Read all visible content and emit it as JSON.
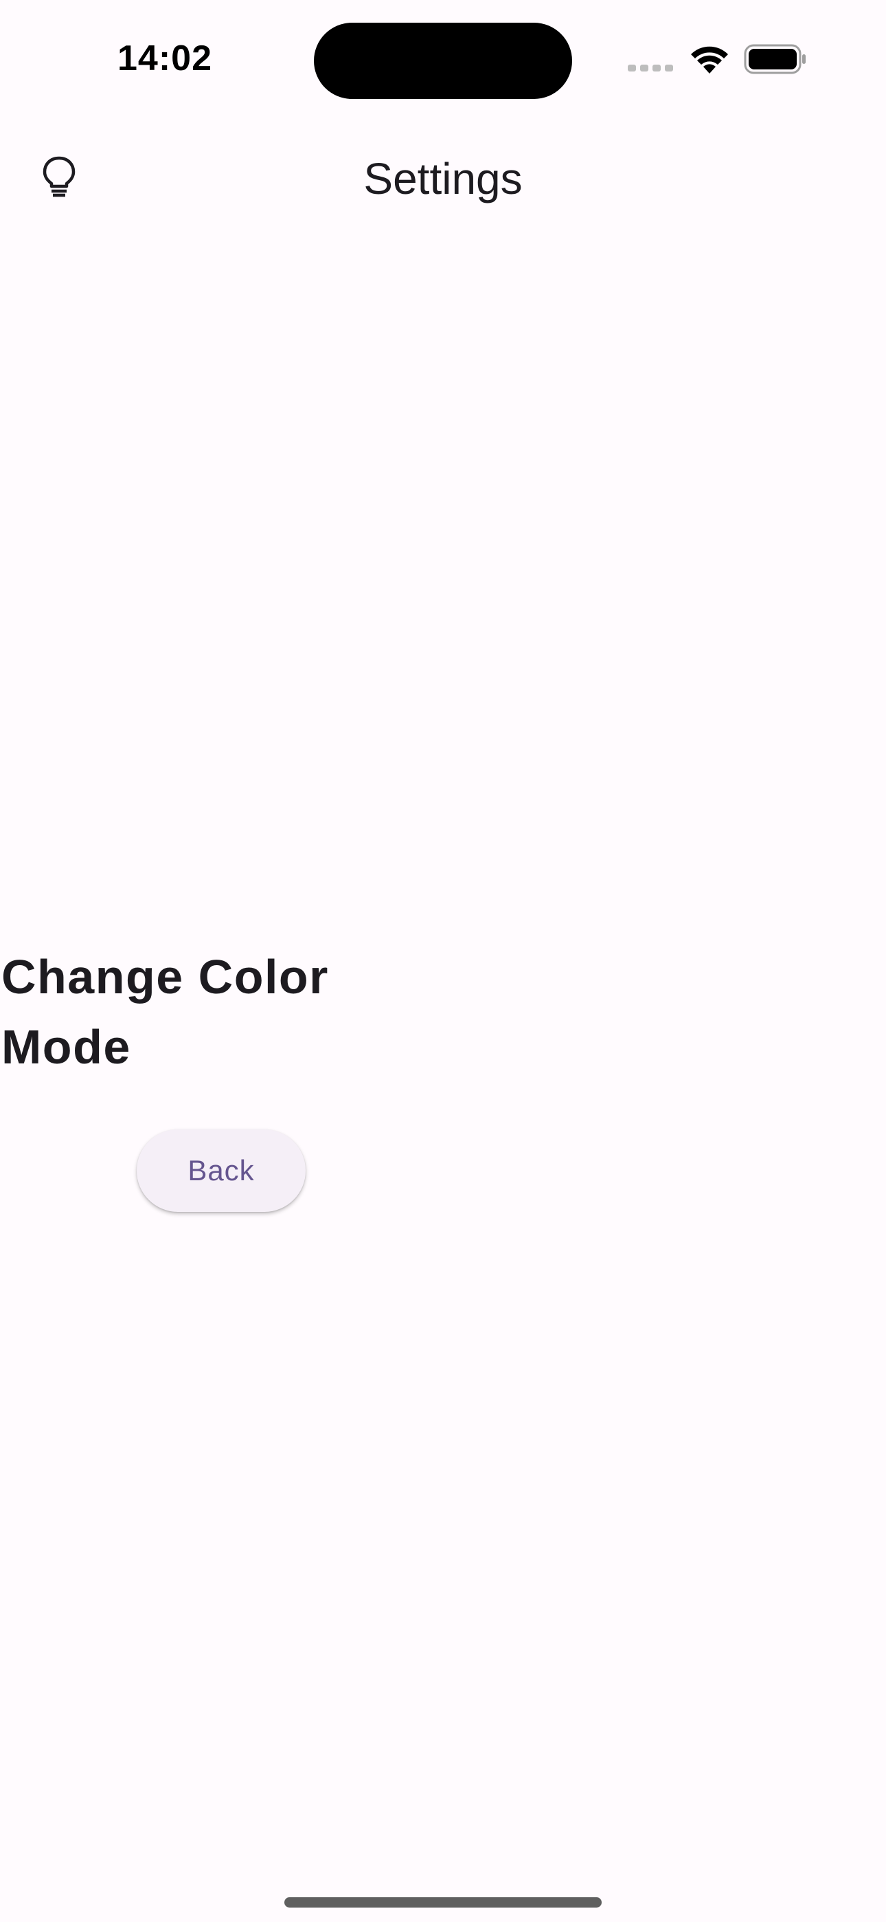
{
  "status_bar": {
    "time": "14:02"
  },
  "app_bar": {
    "title": "Settings",
    "leading_icon": "lightbulb-icon"
  },
  "content": {
    "heading": "Change Color Mode",
    "back_button_label": "Back"
  },
  "colors": {
    "background": "#fffbfe",
    "text": "#1d1b20",
    "button_background": "#f5eff7",
    "button_text": "#65558f"
  }
}
